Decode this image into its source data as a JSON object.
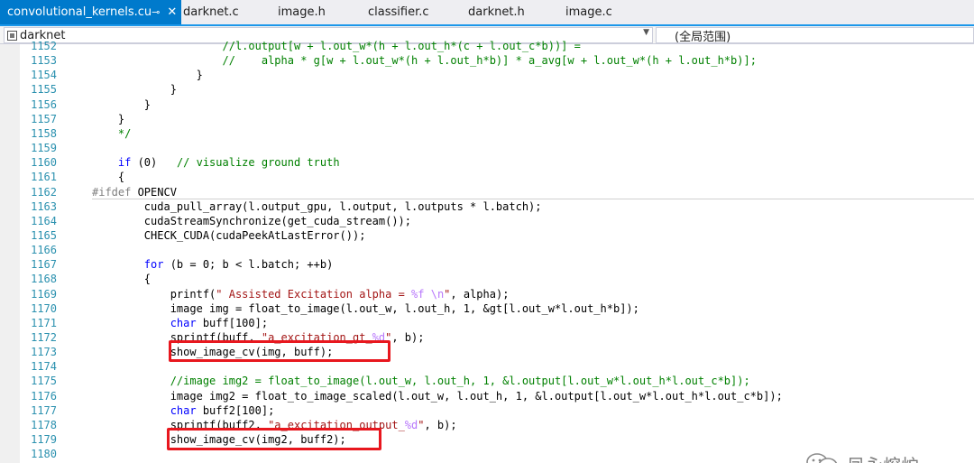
{
  "tabs": [
    {
      "label": "convolutional_kernels.cu",
      "active": true,
      "pin": "⊸",
      "close": "✕"
    },
    {
      "label": "darknet.c"
    },
    {
      "label": "image.h"
    },
    {
      "label": "classifier.c"
    },
    {
      "label": "darknet.h"
    },
    {
      "label": "image.c"
    }
  ],
  "nav": {
    "project": "darknet",
    "scope": "(全局范围)"
  },
  "code_lines": [
    {
      "num": "1152",
      "text": "                    //l.output[w + l.out_w*(h + l.out_h*(c + l.out_c*b))] ="
    },
    {
      "num": "1153",
      "text": "                    //    alpha * g[w + l.out_w*(h + l.out_h*b)] * a_avg[w + l.out_w*(h + l.out_h*b)];"
    },
    {
      "num": "1154",
      "text": "                }"
    },
    {
      "num": "1155",
      "text": "            }"
    },
    {
      "num": "1156",
      "text": "        }"
    },
    {
      "num": "1157",
      "text": "    }"
    },
    {
      "num": "1158",
      "text": "    */"
    },
    {
      "num": "1159",
      "text": ""
    },
    {
      "num": "1160",
      "text": "    if (0)   // visualize ground truth"
    },
    {
      "num": "1161",
      "text": "    {"
    },
    {
      "num": "1162",
      "text": "#ifdef OPENCV"
    },
    {
      "num": "1163",
      "text": "        cuda_pull_array(l.output_gpu, l.output, l.outputs * l.batch);"
    },
    {
      "num": "1164",
      "text": "        cudaStreamSynchronize(get_cuda_stream());"
    },
    {
      "num": "1165",
      "text": "        CHECK_CUDA(cudaPeekAtLastError());"
    },
    {
      "num": "1166",
      "text": ""
    },
    {
      "num": "1167",
      "text": "        for (b = 0; b < l.batch; ++b)"
    },
    {
      "num": "1168",
      "text": "        {"
    },
    {
      "num": "1169",
      "text": "            printf(\" Assisted Excitation alpha = %f \\n\", alpha);"
    },
    {
      "num": "1170",
      "text": "            image img = float_to_image(l.out_w, l.out_h, 1, &gt[l.out_w*l.out_h*b]);"
    },
    {
      "num": "1171",
      "text": "            char buff[100];"
    },
    {
      "num": "1172",
      "text": "            sprintf(buff, \"a_excitation_gt_%d\", b);"
    },
    {
      "num": "1173",
      "text": "            show_image_cv(img, buff);"
    },
    {
      "num": "1174",
      "text": ""
    },
    {
      "num": "1175",
      "text": "            //image img2 = float_to_image(l.out_w, l.out_h, 1, &l.output[l.out_w*l.out_h*l.out_c*b]);"
    },
    {
      "num": "1176",
      "text": "            image img2 = float_to_image_scaled(l.out_w, l.out_h, 1, &l.output[l.out_w*l.out_h*l.out_c*b]);"
    },
    {
      "num": "1177",
      "text": "            char buff2[100];"
    },
    {
      "num": "1178",
      "text": "            sprintf(buff2, \"a_excitation_output_%d\", b);"
    },
    {
      "num": "1179",
      "text": "            show_image_cv(img2, buff2);"
    },
    {
      "num": "1180",
      "text": ""
    }
  ],
  "highlighted_lines": [
    "1173",
    "1179"
  ],
  "watermark": {
    "text": "凤永熔炉",
    "icon": "wechat-icon"
  },
  "colors": {
    "accent": "#007acc",
    "highlight_box": "#e8171e",
    "line_number": "#2b91af",
    "comment": "#008000",
    "keyword": "#0000ff",
    "string": "#a31515"
  }
}
